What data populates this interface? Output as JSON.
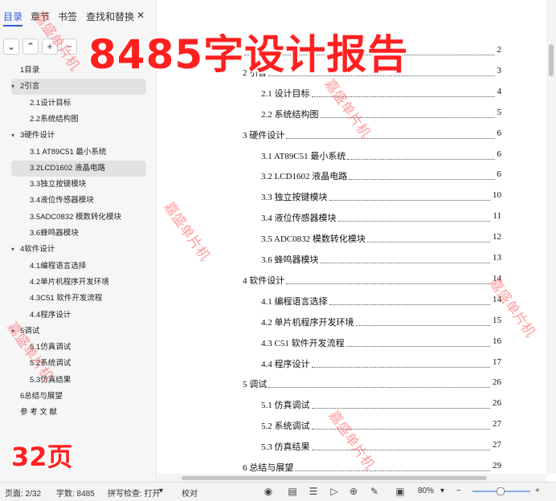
{
  "nav": {
    "tabs": [
      "目录",
      "章节",
      "书签",
      "查找和替换"
    ],
    "close_glyph": "✕",
    "toolbar": [
      "⌄",
      "⌃",
      "+",
      "−"
    ],
    "items": [
      {
        "label": "1目录",
        "level": 1
      },
      {
        "label": "2引言",
        "level": 1,
        "arrow": "▾",
        "selected": true
      },
      {
        "label": "2.1设计目标",
        "level": 2
      },
      {
        "label": "2.2系统结构图",
        "level": 2
      },
      {
        "label": "3硬件设计",
        "level": 1,
        "arrow": "▾"
      },
      {
        "label": "3.1  AT89C51 最小系统",
        "level": 2
      },
      {
        "label": "3.2LCD1602 液晶电路",
        "level": 2,
        "selected": true
      },
      {
        "label": "3.3独立按键模块",
        "level": 2
      },
      {
        "label": "3.4液位传感器模块",
        "level": 2
      },
      {
        "label": "3.5ADC0832 模数转化模块",
        "level": 2
      },
      {
        "label": "3.6蜂鸣器模块",
        "level": 2
      },
      {
        "label": "4软件设计",
        "level": 1,
        "arrow": "▾"
      },
      {
        "label": "4.1编程语言选择",
        "level": 2
      },
      {
        "label": "4.2单片机程序开发环境",
        "level": 2
      },
      {
        "label": "4.3C51 软件开发流程",
        "level": 2
      },
      {
        "label": "4.4程序设计",
        "level": 2
      },
      {
        "label": "5调试",
        "level": 1,
        "arrow": "▾"
      },
      {
        "label": "5.1仿真调试",
        "level": 2
      },
      {
        "label": "5.2系统调试",
        "level": 2
      },
      {
        "label": "5.3仿真结果",
        "level": 2
      },
      {
        "label": "6总结与展望",
        "level": 1
      },
      {
        "label": "参 考 文 献",
        "level": 1
      }
    ]
  },
  "toc": [
    {
      "text": "",
      "page": "2",
      "indent": 0
    },
    {
      "text": "2  引言",
      "page": "3",
      "indent": 0
    },
    {
      "text": "2.1  设计目标",
      "page": "4",
      "indent": 1
    },
    {
      "text": "2.2  系统结构图",
      "page": "5",
      "indent": 1
    },
    {
      "text": "3  硬件设计",
      "page": "6",
      "indent": 0
    },
    {
      "text": "3.1 AT89C51 最小系统",
      "page": "6",
      "indent": 1
    },
    {
      "text": "3.2 LCD1602 液晶电路",
      "page": "6",
      "indent": 1
    },
    {
      "text": "3.3  独立按键模块",
      "page": "10",
      "indent": 1
    },
    {
      "text": "3.4  液位传感器模块",
      "page": "11",
      "indent": 1
    },
    {
      "text": "3.5 ADC0832 模数转化模块",
      "page": "12",
      "indent": 1
    },
    {
      "text": "3.6  蜂鸣器模块",
      "page": "13",
      "indent": 1
    },
    {
      "text": "4  软件设计",
      "page": "14",
      "indent": 0
    },
    {
      "text": "4.1  编程语言选择",
      "page": "14",
      "indent": 1
    },
    {
      "text": "4.2  单片机程序开发环境",
      "page": "15",
      "indent": 1
    },
    {
      "text": "4.3 C51 软件开发流程",
      "page": "16",
      "indent": 1
    },
    {
      "text": "4.4  程序设计",
      "page": "17",
      "indent": 1
    },
    {
      "text": "5  调试",
      "page": "26",
      "indent": 0
    },
    {
      "text": "5.1  仿真调试",
      "page": "26",
      "indent": 1
    },
    {
      "text": "5.2  系统调试",
      "page": "27",
      "indent": 1
    },
    {
      "text": "5.3  仿真结果",
      "page": "27",
      "indent": 1
    },
    {
      "text": "6 总结与展望",
      "page": "29",
      "indent": 0
    }
  ],
  "status": {
    "page": "页面: 2/32",
    "words": "字数: 8485",
    "spell": "拼写检查: 打开",
    "proof": "校对",
    "zoom": "80%"
  },
  "overlay": {
    "banner": "8485字设计报告",
    "pages": "32页",
    "watermark": "嘉盛单片机"
  }
}
